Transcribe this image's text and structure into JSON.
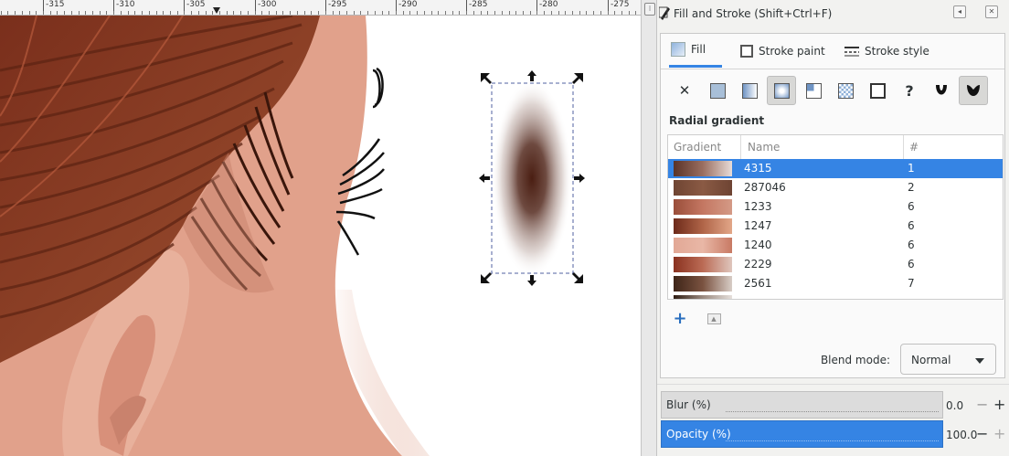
{
  "ruler": {
    "labels": [
      "-315",
      "-310",
      "-305",
      "-300",
      "-295",
      "-290",
      "-285",
      "-280",
      "-275"
    ]
  },
  "panel": {
    "title": "Fill and Stroke (Shift+Ctrl+F)",
    "tabs": [
      {
        "label": "Fill",
        "icon": "fill-swatch-icon",
        "active": true
      },
      {
        "label": "Stroke paint",
        "icon": "stroke-paint-icon",
        "active": false
      },
      {
        "label": "Stroke style",
        "icon": "stroke-style-icon",
        "active": false
      }
    ],
    "paint_modes": [
      {
        "name": "no-paint-icon",
        "glyph": "✕"
      },
      {
        "name": "flat-color-icon"
      },
      {
        "name": "linear-gradient-icon"
      },
      {
        "name": "radial-gradient-icon",
        "selected": true
      },
      {
        "name": "mesh-gradient-icon"
      },
      {
        "name": "pattern-icon"
      },
      {
        "name": "swatch-icon"
      },
      {
        "name": "unset-paint-icon",
        "glyph": "?"
      },
      {
        "name": "fill-rule-evenodd-icon"
      },
      {
        "name": "fill-rule-nonzero-icon"
      }
    ],
    "gradient_type_title": "Radial gradient",
    "gradient_table": {
      "headers": {
        "gradient": "Gradient",
        "name": "Name",
        "count": "#"
      },
      "rows": [
        {
          "name": "4315",
          "count": "1",
          "selected": true,
          "colors": [
            "#5a3328",
            "#9a6e60",
            "#e8dcd8"
          ]
        },
        {
          "name": "287046",
          "count": "2",
          "colors": [
            "#6f4533",
            "#8a5a44",
            "#6e4433"
          ]
        },
        {
          "name": "1233",
          "count": "6",
          "colors": [
            "#9a4e3a",
            "#c47762",
            "#d49a86"
          ]
        },
        {
          "name": "1247",
          "count": "6",
          "colors": [
            "#6d2a1a",
            "#b06548",
            "#e2a688"
          ]
        },
        {
          "name": "1240",
          "count": "6",
          "colors": [
            "#e2a896",
            "#e9b7a6",
            "#c87a64"
          ]
        },
        {
          "name": "2229",
          "count": "6",
          "colors": [
            "#8a3220",
            "#bb6b55",
            "#dfc6bd"
          ]
        },
        {
          "name": "2561",
          "count": "7",
          "colors": [
            "#3e2518",
            "#7a5240",
            "#d8cdc6"
          ]
        },
        {
          "name": "",
          "count": "",
          "colors": [
            "#2e1c12",
            "#9a8a80",
            "#e6e0dc"
          ]
        }
      ]
    },
    "blend_mode": {
      "label": "Blend mode:",
      "value": "Normal"
    },
    "blur": {
      "label": "Blur (%)",
      "value": "0.0",
      "fraction": 0.0
    },
    "opacity": {
      "label": "Opacity (%)",
      "value": "100.0",
      "fraction": 1.0
    }
  },
  "colors": {
    "accent": "#3584e4",
    "hair": "#8a3c26",
    "skin": "#e0a08a",
    "object_center": "#4a1e12"
  }
}
